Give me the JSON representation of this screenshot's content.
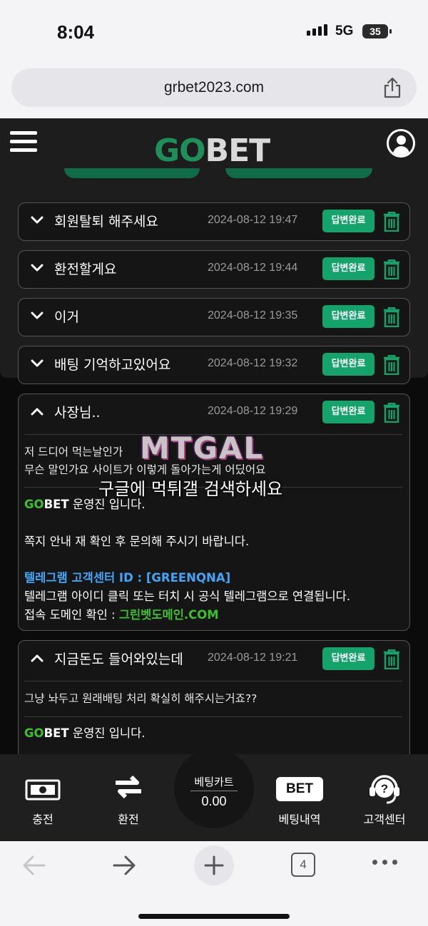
{
  "status": {
    "time": "8:04",
    "network": "5G",
    "battery": "35"
  },
  "browser": {
    "url": "grbet2023.com",
    "tab_count": "4"
  },
  "header": {
    "logo_go": "GO",
    "logo_bet": "BET"
  },
  "inquiries": [
    {
      "title": "회원탈퇴 해주세요",
      "date": "2024-08-12 19:47",
      "status": "답변완료",
      "expanded": false
    },
    {
      "title": "환전할게요",
      "date": "2024-08-12 19:44",
      "status": "답변완료",
      "expanded": false
    },
    {
      "title": "이거",
      "date": "2024-08-12 19:35",
      "status": "답변완료",
      "expanded": false
    },
    {
      "title": "배팅 기억하고있어요",
      "date": "2024-08-12 19:32",
      "status": "답변완료",
      "expanded": false
    },
    {
      "title": "사장님..",
      "date": "2024-08-12 19:29",
      "status": "답변완료",
      "expanded": true,
      "question": [
        "저 드디어 먹는날인가",
        "무슨 말인가요 사이트가 이렇게 돌아가는게 어딨어요"
      ],
      "answer": {
        "brand_go": "GO",
        "brand_bet": "BET",
        "intro": " 운영진 입니다.",
        "line2": "쪽지 안내 재 확인 후 문의해 주시기 바랍니다.",
        "telegram_id": "텔레그램 고객센터 ID : [GREENQNA]",
        "telegram_note": "텔레그램 아이디 클릭 또는 터치 시 공식 텔레그램으로 연결됩니다.",
        "domain_label": "접속 도메인 확인 : ",
        "domain_value": "그린벳도메인.COM"
      }
    },
    {
      "title": "지금돈도 들어와있는데",
      "date": "2024-08-12 19:21",
      "status": "답변완료",
      "expanded": true,
      "question": [
        "그냥 놔두고 원래배팅 처리 확실히 해주시는거죠??"
      ],
      "answer": {
        "brand_go": "GO",
        "brand_bet": "BET",
        "intro": " 운영진 입니다."
      }
    }
  ],
  "watermark": {
    "logo": "MTGAL",
    "text": "구글에 먹튀갤 검색하세요"
  },
  "bottom_nav": {
    "deposit": "충전",
    "withdraw": "환전",
    "cart_label": "베팅카트",
    "cart_value": "0.00",
    "history_icon_text": "BET",
    "history": "베팅내역",
    "support": "고객센터"
  },
  "colors": {
    "accent": "#14a46b",
    "brand_green": "#1f8f5a",
    "link_blue": "#42a5f5",
    "domain_green": "#3cc02e"
  }
}
